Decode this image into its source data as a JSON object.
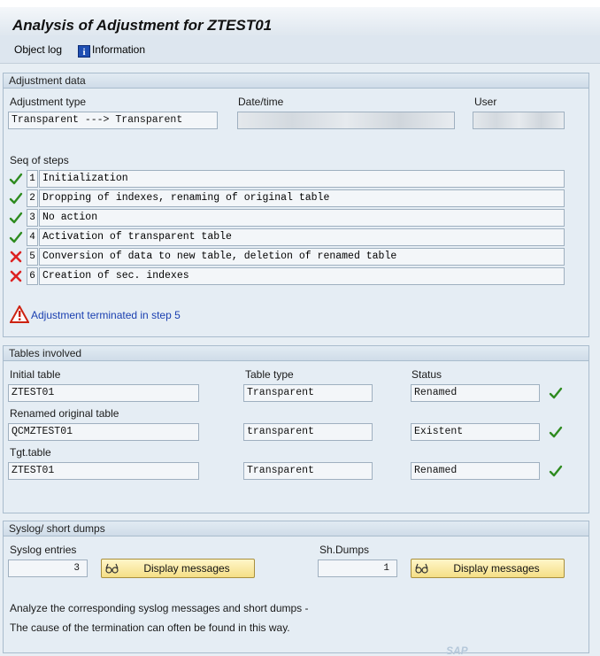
{
  "window": {
    "title": "Analysis of Adjustment for ZTEST01"
  },
  "toolbar": {
    "object_log": "Object log",
    "information": "Information"
  },
  "adjustment": {
    "group_title": "Adjustment data",
    "type_label": "Adjustment type",
    "type_value": "Transparent ---> Transparent",
    "datetime_label": "Date/time",
    "user_label": "User",
    "seq_label": "Seq of steps",
    "steps": [
      {
        "num": "1",
        "text": "Initialization",
        "status": "ok"
      },
      {
        "num": "2",
        "text": "Dropping of indexes, renaming of original table",
        "status": "ok"
      },
      {
        "num": "3",
        "text": "No action",
        "status": "ok"
      },
      {
        "num": "4",
        "text": "Activation of transparent table",
        "status": "ok"
      },
      {
        "num": "5",
        "text": "Conversion of data to new table, deletion of renamed table",
        "status": "error"
      },
      {
        "num": "6",
        "text": "Creation of sec. indexes",
        "status": "error"
      }
    ],
    "warning": "Adjustment terminated in step 5"
  },
  "tables": {
    "group_title": "Tables involved",
    "initial_label": "Initial table",
    "type_label": "Table type",
    "status_label": "Status",
    "renamed_label": "Renamed original table",
    "tgt_label": "Tgt.table",
    "rows": [
      {
        "name": "ZTEST01",
        "type": "Transparent",
        "status": "Renamed"
      },
      {
        "name": "QCMZTEST01",
        "type": "transparent",
        "status": "Existent"
      },
      {
        "name": "ZTEST01",
        "type": "Transparent",
        "status": "Renamed"
      }
    ]
  },
  "syslog": {
    "group_title": "Syslog/ short dumps",
    "entries_label": "Syslog entries",
    "entries_value": "3",
    "dumps_label": "Sh.Dumps",
    "dumps_value": "1",
    "display_btn": "Display messages",
    "note1": "Analyze the corresponding syslog messages and short dumps -",
    "note2": "The cause of the termination can often be found in this way."
  },
  "footer": {
    "logo": "SAP"
  },
  "colors": {
    "accent": "#1a3fb0",
    "ok": "#2e8b1f",
    "error": "#d22",
    "button": "#f5df86"
  }
}
